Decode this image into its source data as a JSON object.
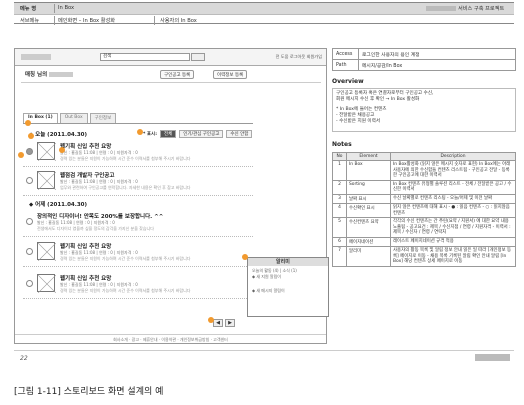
{
  "header": {
    "menu_label": "메뉴 명",
    "menu_value": "In Box",
    "service_right": "서비스 구축 프로젝트",
    "submenu_label": "서브메뉴",
    "submenu_value": "메인화면 – In Box 활성화",
    "screen_title": "사용자의 In Box"
  },
  "wireframe": {
    "top_links": "전 도움 로그아웃 회원가입",
    "greeting": "매칭 님의",
    "btn_post": "구인공고 등록",
    "btn_resume": "이력정보 등록",
    "tabs": [
      "In Box (1)",
      "Out Box",
      "구인정보"
    ],
    "today_header": "◆ 오늘 (2011.04.30)",
    "sort_label": "* 표시:",
    "sort_options": [
      "전체",
      "인기/관심 구인공고",
      "수신 안함"
    ],
    "yesterday_header": "◆ 어제 (2011.04.30)",
    "items": [
      {
        "title": "웹기획 신입 추천 요망",
        "meta": "발신 : 홍길동 11:08  | 연령 : 0 | 지원자격 : 0",
        "desc": "경력 있는 분들은 지원이 가능하며 시간 준수 이력서를 첨부해 주시기 바랍니다"
      },
      {
        "title": "웹점검 개발자 구인공고",
        "meta": "발신 : 홍길동 11:08  | 연령 : 0 | 지원자격 : 0",
        "desc": "업무와 관련하여 구인공고를 연락합니다. 자세한 내용은 확인 후 참고 바랍니다"
      },
      {
        "title": "장의적인 디자이너! 안목도 200%를 보장합니다. ^^",
        "meta": "발신 : 홍길동 11:08  | 연령 : 0 | 지원자격 : 0",
        "desc": "전생에서도 디자이너 였을까 싶을 정도의 감각을 가지신 분을 찾습니다"
      },
      {
        "title": "웹기획 신입 추천 요망",
        "meta": "발신 : 홍길동 11:08  | 연령 : 0 | 지원자격 : 0",
        "desc": "경력 있는 분들은 지원이 가능하며 시간 준수 이력서를 첨부해 주시기 바랍니다"
      },
      {
        "title": "웹기획 신입 추천 요망",
        "meta": "발신 : 홍길동 11:08  | 연령 : 0 | 지원자격 : 0",
        "desc": "경력 있는 분들은 지원이 가능하며 시간 준수 이력서를 첨부해 주시기 바랍니다"
      }
    ],
    "popup_title": "알리미",
    "popup_sub": "오늘의 활동 (4) | 소식 (1)",
    "popup_line1": "◆ 새 지원 알림이",
    "popup_line2": "◆ 새 메시지 알림이",
    "pager_prev": "◀",
    "pager_next": "▶",
    "footer": "회사소개 · 광고 · 제휴안내 · 이용약관 · 개인정보취급방침 · 고객센터"
  },
  "info": {
    "rows": [
      {
        "key": "Access",
        "value": "로그인한 사용자의 용인 계정"
      },
      {
        "key": "Path",
        "value": "메시지/공감/In Box"
      }
    ]
  },
  "overview": {
    "title": "Overview",
    "lines": [
      "구인공고 등록자 혹은 연결자로부터 구인공고 수신,",
      "회원 메시지 수신 후 확인 → In Box 활성화",
      "",
      "* In Box에 들어는 컨텐츠",
      "- 전달받은 채용공고",
      "- 수신받은 지원 이력서"
    ]
  },
  "notes": {
    "title": "Notes",
    "headers": [
      "No",
      "Element",
      "Description"
    ],
    "rows": [
      {
        "no": "1",
        "el": "In Box",
        "desc": "In Box활성화 (읽지 않은 메시지 숫자로 표현) In Box에는 아래 사용자에 의한 수신함들 컨텐츠 리스트됨 - 구인공고 전달 - 등록한 구인공고에 대한 이력서"
      },
      {
        "no": "2",
        "el": "Sorting",
        "desc": "In Box 컨텐츠 유형별 솔루션 리스트 - 전체 / 전달받은 공고 / 수신한 이력서"
      },
      {
        "no": "3",
        "el": "날짜 표시",
        "desc": "수신 날짜별로 컨텐츠 리스팅 - 오늘/어제 및 이전 날짜"
      },
      {
        "no": "4",
        "el": "수신확인 표시",
        "desc": "읽지 않은 컨텐츠에 대해 표시 - ● : 읽음 컨텐츠 - ○ : 읽지않음 컨텐츠"
      },
      {
        "no": "5",
        "el": "수신컨텐츠 요약",
        "desc": "각각의 수신 컨텐츠는 간 추린(요약 / 지원서) 에 대한 요약 내용 노출됨 - 공고요건 : 제목 / 수신지점 / 연령 / 지원자격 - 이력서 : 제목 / 수신자 / 연령 / 연락처"
      },
      {
        "no": "6",
        "el": "페이지네이션",
        "desc": "레이스트 페이지네이션 규격 적용"
      },
      {
        "no": "7",
        "el": "알리미",
        "desc": "사용자의 활동 목록 및 알림 정보 안내 읽은 일 따라 [개인정보 등록] 페이지로 이동 - 채용 목록 기록된 알림 확인 안내 알림 [In Box] 해당 컨텐츠 상세 페이지로 이동"
      }
    ]
  },
  "page_number": "22",
  "caption": "[그림 1-11] 스토리보드 화면 설계의 예"
}
